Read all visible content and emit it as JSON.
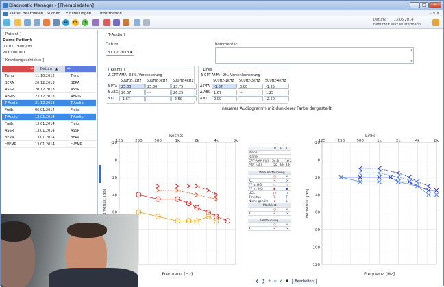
{
  "window": {
    "title": "Diagnostic Manager - [Therapiedaten]"
  },
  "menu": [
    "Datei",
    "Bearbeiten",
    "Suchen",
    "Einstellungen",
    "Information"
  ],
  "toolbar": {
    "circles": [
      "ES",
      "DS",
      "TS"
    ]
  },
  "user": {
    "date_label": "Datum:",
    "date": "13.05.2014",
    "user_label": "Benutzer:",
    "user": "Max Mustermann"
  },
  "patient": {
    "section": "[ Patient ]",
    "name": "Demo Patient",
    "dob": "01.01.1900 / m",
    "pid": "PID:100000"
  },
  "history": {
    "section": "[ Krankengeschichte ]",
    "header": "Datum",
    "rows": [
      {
        "a": "Tymp",
        "date": "11.10.2012",
        "b": "Tymp",
        "sel": false
      },
      {
        "a": "BERA",
        "date": "20.12.2013",
        "b": "BERA",
        "sel": false
      },
      {
        "a": "ASSR",
        "date": "20.12.2013",
        "b": "ASSR",
        "sel": false
      },
      {
        "a": "ABRIS",
        "date": "23.12.2013",
        "b": "ABRIS",
        "sel": false
      },
      {
        "a": "T-Audio",
        "date": "31.12.2013",
        "b": "T-Audio",
        "sel": true
      },
      {
        "a": "Freib.",
        "date": "06.01.2014",
        "b": "Freib.",
        "sel": false
      },
      {
        "a": "T-Audio",
        "date": "13.01.2014",
        "b": "T-Audio",
        "sel": true
      },
      {
        "a": "Freib.",
        "date": "13.01.2014",
        "b": "Freib.",
        "sel": false
      },
      {
        "a": "ASSR",
        "date": "13.01.2014",
        "b": "ASSR",
        "sel": false
      },
      {
        "a": "BERA",
        "date": "13.01.2014",
        "b": "BERA",
        "sel": false
      },
      {
        "a": "cVEMP",
        "date": "13.01.2014",
        "b": "cVEMP",
        "sel": false
      }
    ]
  },
  "main": {
    "section": "[ T-Audio ]",
    "datum_label": "Datum:",
    "datum_value": "31.12.2013",
    "kommentar_label": "Kommentar:",
    "note": "neueres Audiogramm mit dunklerer Farbe dargestellt"
  },
  "rechts": {
    "section": "[ Rechts ]",
    "summary": "Δ CPT-AMA: 33%, Verbesserung",
    "cols": [
      "500Hz-1kHz",
      "500Hz-3kHz",
      "500Hz-4kHz"
    ],
    "rows": [
      {
        "label": "Δ PTA",
        "vals": [
          "25.00",
          "25.00",
          "23.75"
        ]
      },
      {
        "label": "Δ ABG",
        "vals": [
          "26.67",
          "---",
          "26.25"
        ]
      },
      {
        "label": "Δ KL",
        "vals": [
          "-1.67",
          "---",
          "-2.50"
        ]
      }
    ]
  },
  "links": {
    "section": "[ Links ]",
    "summary": "Δ CPT-AMA: -2%, Verschlechterung",
    "cols": [
      "500Hz-1kHz",
      "500Hz-3kHz",
      "500Hz-4kHz"
    ],
    "rows": [
      {
        "label": "Δ PTA",
        "vals": [
          "-1.67",
          "0.00",
          "-1.25"
        ]
      },
      {
        "label": "Δ ABG",
        "vals": [
          "1.67",
          "---",
          "1.25"
        ]
      },
      {
        "label": "Δ KL",
        "vals": [
          "0.00",
          "---",
          "-2.50"
        ]
      }
    ]
  },
  "legend": {
    "header": [
      "R",
      "B",
      "L"
    ],
    "weber": "Weber",
    "rinne": "Rinne",
    "cpt": {
      "label": "CPT-AMA [%]",
      "vals": [
        "54.8",
        "",
        "16.2"
      ]
    },
    "pta": {
      "label": "PTA [dB]",
      "vals": [
        "50",
        "39",
        "29"
      ]
    },
    "ohne": "Ohne Vertäubung",
    "items": [
      "LL",
      "KL",
      "FF o. HG",
      "FF m. HG",
      "UCL",
      "Tinnitus",
      "Nicht gehört"
    ],
    "maskiert": "Maskiert",
    "mitems": [
      "LL",
      "KL"
    ],
    "vertaeubung": "Vertäubung",
    "vitems": [
      "LL",
      "KL"
    ]
  },
  "chart_data": [
    {
      "type": "line",
      "title": "Rechts",
      "xlabel": "Frequenz (Hz)",
      "ylabel": "Hörverlust [dB]",
      "x_ticks": [
        "125",
        "250",
        "500",
        "1k",
        "2k",
        "4k",
        "8k"
      ],
      "y_ticks": [
        -20,
        0,
        20,
        40,
        60,
        80,
        100,
        120
      ],
      "ylim": [
        -20,
        120
      ],
      "series": [
        {
          "name": "LL dark",
          "color": "#e02020",
          "x": [
            "250",
            "500",
            "1k",
            "1.5k",
            "2k",
            "3k",
            "4k",
            "6k"
          ],
          "values": [
            40,
            45,
            45,
            50,
            55,
            60,
            65,
            70
          ]
        },
        {
          "name": "KL dark",
          "color": "#e02020",
          "x": [
            "500",
            "1k",
            "1.5k",
            "2k",
            "3k",
            "4k"
          ],
          "values": [
            30,
            30,
            30,
            30,
            35,
            40
          ]
        },
        {
          "name": "LL light",
          "color": "#f0a020",
          "x": [
            "250",
            "500",
            "1k",
            "1.5k",
            "2k",
            "3k",
            "4k"
          ],
          "values": [
            60,
            65,
            70,
            70,
            70,
            65,
            70
          ]
        },
        {
          "name": "KL light",
          "color": "#f05020",
          "x": [
            "500",
            "1k",
            "2k",
            "4k"
          ],
          "values": [
            35,
            35,
            40,
            45
          ]
        }
      ]
    },
    {
      "type": "line",
      "title": "Links",
      "xlabel": "Frequenz [Hz]",
      "ylabel": "Hörverlust [dB]",
      "x_ticks": [
        "125",
        "250",
        "500",
        "1k",
        "2k",
        "4k",
        "8k"
      ],
      "y_ticks": [
        -20,
        0,
        20,
        40,
        60,
        80,
        100,
        120
      ],
      "ylim": [
        -20,
        120
      ],
      "series": [
        {
          "name": "LL dark",
          "color": "#2a3fd6",
          "x": [
            "250",
            "500",
            "1k",
            "1.5k",
            "2k",
            "3k",
            "4k",
            "6k",
            "8k"
          ],
          "values": [
            20,
            20,
            20,
            20,
            25,
            25,
            30,
            35,
            35
          ]
        },
        {
          "name": "KL dark",
          "color": "#2a3fd6",
          "x": [
            "500",
            "1k",
            "2k",
            "3k",
            "4k",
            "6k"
          ],
          "values": [
            10,
            10,
            15,
            20,
            25,
            30
          ]
        },
        {
          "name": "LL light",
          "color": "#5a8ae8",
          "x": [
            "250",
            "500",
            "1k",
            "2k",
            "4k",
            "6k",
            "8k"
          ],
          "values": [
            20,
            25,
            25,
            25,
            30,
            40,
            40
          ]
        },
        {
          "name": "KL light",
          "color": "#5a8ae8",
          "x": [
            "500",
            "1k",
            "2k",
            "4k"
          ],
          "values": [
            15,
            15,
            20,
            25
          ]
        }
      ]
    }
  ],
  "bottom": {
    "search_label": "Bearbeiten"
  }
}
